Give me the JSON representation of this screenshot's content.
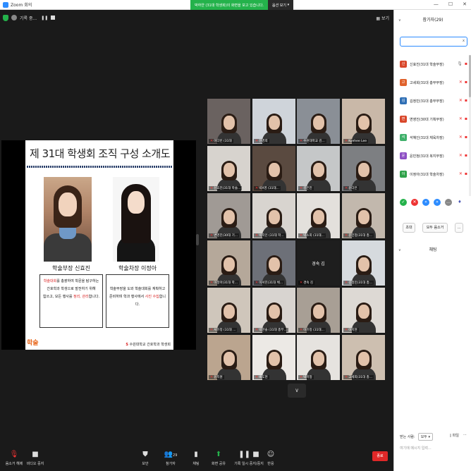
{
  "window": {
    "title": "Zoom 회의",
    "minimize": "—",
    "maximize": "☐",
    "close": "✕"
  },
  "share_banner": {
    "status": "박하얀 (31대 학생회)의 화면을 보고 있습니다.",
    "options_label": "옵션 보기"
  },
  "topbar": {
    "recording_label": "기록 중...",
    "pause_glyph": "❚❚",
    "view_label": "보기"
  },
  "slide": {
    "title": "제 31대 학생회 조직 구성 소개도",
    "role_left": "학술부장 신효진",
    "role_right": "학술차장 이정아",
    "box_left": {
      "l1_hl": "학술대회",
      "l1_rest": "를 총괄하여 학문을 탐구하는",
      "l2": "간호학과 학생으로 발전하기 위해",
      "l3_a": "힘쓰고, 모든 행사를 ",
      "l3_hl": "정리, 관리",
      "l3_b": "합니다."
    },
    "box_right": {
      "l1": "학술부장을 도와 학술대회를 계획하고",
      "l2_a": "준비하며 학과 행사에서 ",
      "l2_hl": "사진 수집",
      "l2_b": "합니다."
    },
    "footer_icon": "S",
    "footer_text": "수원대학교 간호학과 학생회",
    "mascot": "학술"
  },
  "tiles": [
    {
      "label": "이다빈 (31대"
    },
    {
      "label": "한경희"
    },
    {
      "label": "수원대학교 김..."
    },
    {
      "label": "Kyehee Lee"
    },
    {
      "label": "신효진(31대 학술..."
    },
    {
      "label": "박X영 (31대..."
    },
    {
      "label": "김은진"
    },
    {
      "label": "윤다은"
    },
    {
      "label": "변영진(30대 기..."
    },
    {
      "label": "박지인 (31대 학..."
    },
    {
      "label": "박소희 (31대..."
    },
    {
      "label": "윤민정(31대 총..."
    },
    {
      "label": "이정아(31대 학..."
    },
    {
      "label": "이서진(31대 체..."
    },
    {
      "label": "경숙 김",
      "center": "경숙 김"
    },
    {
      "label": "김정민(31대 총..."
    },
    {
      "label": "서유정 (31대 ..."
    },
    {
      "label": "박한솔 (31대 총무..."
    },
    {
      "label": "이유정 (31대..."
    },
    {
      "label": "이지현"
    },
    {
      "label": "윤지원"
    },
    {
      "label": "배도현"
    },
    {
      "label": "박미정"
    },
    {
      "label": "고세희(31대 총..."
    }
  ],
  "more_glyph": "∨",
  "toolbar": {
    "mute_label": "음소거 해제",
    "video_label": "비디오 중지",
    "security_label": "보안",
    "participants_label": "참가자",
    "participants_count": "29",
    "chat_label": "채팅",
    "share_label": "화면 공유",
    "record_label": "기록 일시 중지/중지",
    "reactions_label": "반응",
    "end_label": "종료"
  },
  "sidebar": {
    "participants_header": "참가자(29)",
    "search_clear": "x",
    "participants": [
      {
        "initial": "신",
        "name": "신효진(31대 학술부장)",
        "color": "#d9472b",
        "mic": "on"
      },
      {
        "initial": "고",
        "name": "고세희(31대 총무부장)",
        "color": "#e0622c",
        "mic": "off"
      },
      {
        "initial": "김",
        "name": "김정민(31대 총무부장)",
        "color": "#2f6fb5",
        "mic": "off"
      },
      {
        "initial": "변",
        "name": "변영진(30대 기획부장)",
        "color": "#d9472b",
        "mic": "off"
      },
      {
        "initial": "석",
        "name": "석혜인(31대 체육차장)",
        "color": "#3fb06a",
        "mic": "off"
      },
      {
        "initial": "윤",
        "name": "윤민정(31대 복지부장)",
        "color": "#8d4fc4",
        "mic": "off"
      },
      {
        "initial": "이",
        "name": "이정아(31대 학술차장)",
        "color": "#2fa24a",
        "mic": "off"
      }
    ],
    "invite_label": "초대",
    "mute_all_label": "모두 음소거",
    "more_label": "...",
    "chat_header": "채팅",
    "chat_to_label": "받는 사람:",
    "chat_to_value": "모두",
    "file_label": "파일",
    "chat_placeholder": "여기에 메시지 입력..."
  },
  "colors": {
    "accent": "#2d8cff",
    "green": "#24b24b",
    "end_red": "#e02828"
  }
}
